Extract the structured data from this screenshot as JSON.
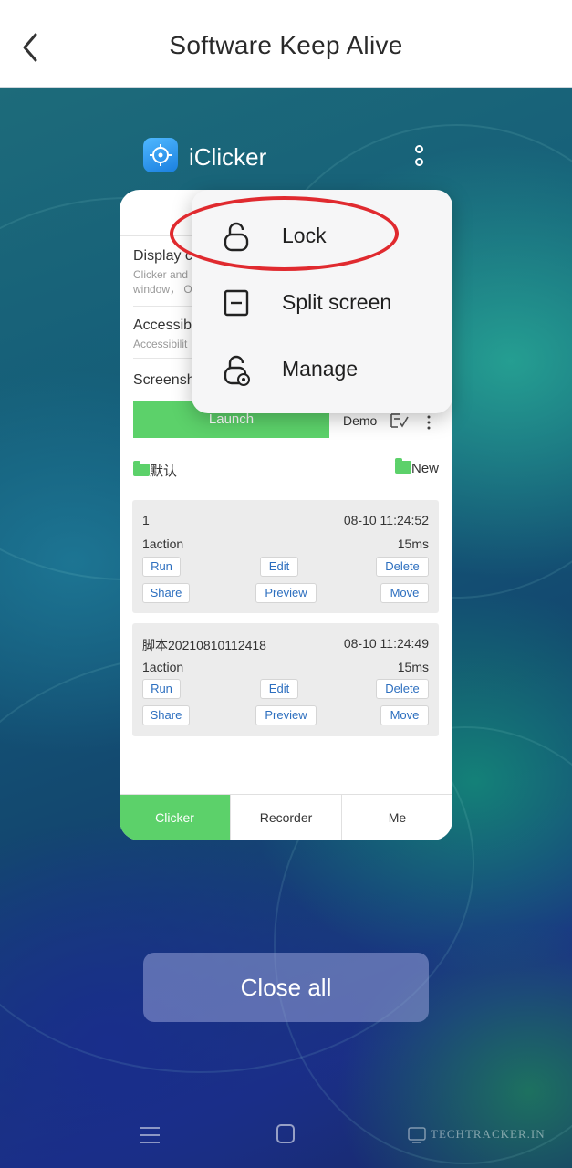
{
  "header": {
    "title": "Software Keep Alive"
  },
  "app": {
    "name": "iClicker"
  },
  "card": {
    "settings": [
      {
        "title": "Display c",
        "sub1": "Clicker and",
        "sub2": "window， O"
      },
      {
        "title": "Accessib",
        "sub1": "Accessibilit"
      },
      {
        "title": "Screensh"
      }
    ],
    "launch_label": "Launch",
    "demo_label": "Demo",
    "folder_left": "默认",
    "folder_right": "New",
    "scripts": [
      {
        "name": "1",
        "time": "08-10 11:24:52",
        "actions": "1action",
        "duration": "15ms",
        "run": "Run",
        "edit": "Edit",
        "delete": "Delete",
        "share": "Share",
        "preview": "Preview",
        "move": "Move"
      },
      {
        "name": "脚本20210810112418",
        "time": "08-10 11:24:49",
        "actions": "1action",
        "duration": "15ms",
        "run": "Run",
        "edit": "Edit",
        "delete": "Delete",
        "share": "Share",
        "preview": "Preview",
        "move": "Move"
      }
    ],
    "tabs": [
      {
        "label": "Clicker"
      },
      {
        "label": "Recorder"
      },
      {
        "label": "Me"
      }
    ]
  },
  "menu": {
    "items": [
      {
        "label": "Lock",
        "icon": "lock-icon"
      },
      {
        "label": "Split screen",
        "icon": "split-screen-icon"
      },
      {
        "label": "Manage",
        "icon": "manage-lock-icon"
      }
    ]
  },
  "close_all_label": "Close all",
  "watermark": "TECHTRACKER.IN",
  "colors": {
    "accent_green": "#5cd16a",
    "highlight_red": "#e02a2f",
    "link_blue": "#2d6fbf"
  }
}
